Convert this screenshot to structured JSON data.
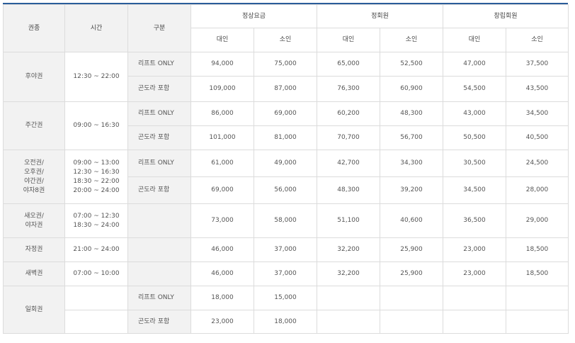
{
  "headers": {
    "ticket_type": "권종",
    "time": "시간",
    "category": "구분",
    "regular": "정상요금",
    "member": "정회원",
    "founder": "창립회원",
    "adult": "대인",
    "child": "소인"
  },
  "rows": {
    "r1": {
      "ticket": "후야권",
      "time": "12:30 ~ 22:00",
      "a": {
        "cat": "리프트 ONLY",
        "v": [
          "94,000",
          "75,000",
          "65,000",
          "52,500",
          "47,000",
          "37,500"
        ]
      },
      "b": {
        "cat": "곤도라 포함",
        "v": [
          "109,000",
          "87,000",
          "76,300",
          "60,900",
          "54,500",
          "43,500"
        ]
      }
    },
    "r2": {
      "ticket": "주간권",
      "time": "09:00 ~ 16:30",
      "a": {
        "cat": "리프트 ONLY",
        "v": [
          "86,000",
          "69,000",
          "60,200",
          "48,300",
          "43,000",
          "34,500"
        ]
      },
      "b": {
        "cat": "곤도라 포함",
        "v": [
          "101,000",
          "81,000",
          "70,700",
          "56,700",
          "50,500",
          "40,500"
        ]
      }
    },
    "r3": {
      "ticket": [
        "오전권/",
        "오후권/",
        "야간권/",
        "야자8권"
      ],
      "time": [
        "09:00 ~ 13:00",
        "12:30 ~ 16:30",
        "18:30 ~ 22:00",
        "20:00 ~ 24:00"
      ],
      "a": {
        "cat": "리프트 ONLY",
        "v": [
          "61,000",
          "49,000",
          "42,700",
          "34,300",
          "30,500",
          "24,500"
        ]
      },
      "b": {
        "cat": "곤도라 포함",
        "v": [
          "69,000",
          "56,000",
          "48,300",
          "39,200",
          "34,500",
          "28,000"
        ]
      }
    },
    "r4": {
      "ticket": [
        "새오권/",
        "야자권"
      ],
      "time": [
        "07:00 ~ 12:30",
        "18:30 ~ 24:00"
      ],
      "v": [
        "73,000",
        "58,000",
        "51,100",
        "40,600",
        "36,500",
        "29,000"
      ]
    },
    "r5": {
      "ticket": "자정권",
      "time": "21:00 ~ 24:00",
      "v": [
        "46,000",
        "37,000",
        "32,200",
        "25,900",
        "23,000",
        "18,500"
      ]
    },
    "r6": {
      "ticket": "새벽권",
      "time": "07:00 ~ 10:00",
      "v": [
        "46,000",
        "37,000",
        "32,200",
        "25,900",
        "23,000",
        "18,500"
      ]
    },
    "r7": {
      "ticket": "일회권",
      "a": {
        "cat": "리프트 ONLY",
        "v": [
          "18,000",
          "15,000"
        ]
      },
      "b": {
        "cat": "곤도라 포함",
        "v": [
          "23,000",
          "18,000"
        ]
      }
    }
  }
}
